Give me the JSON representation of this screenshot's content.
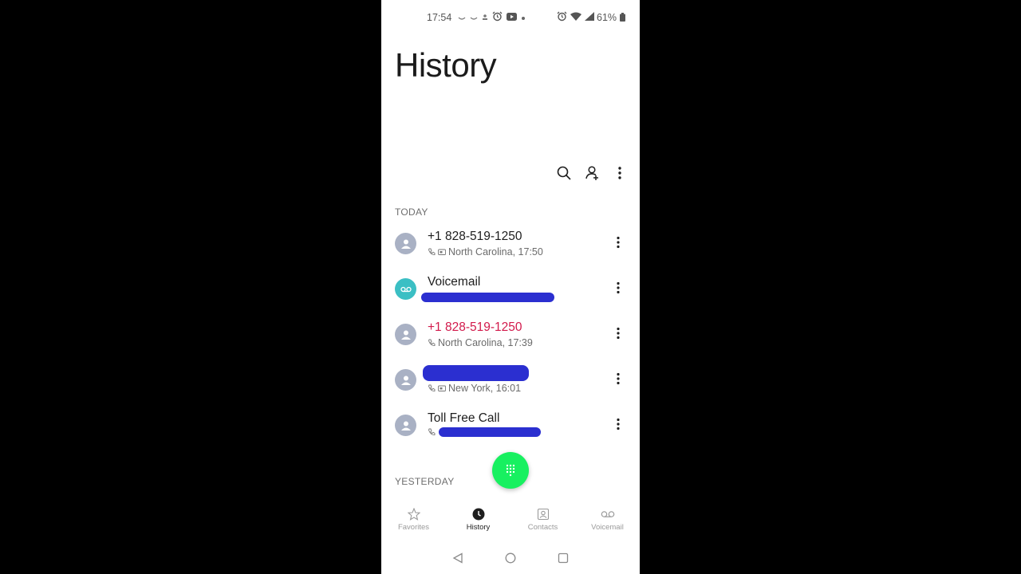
{
  "status_bar": {
    "time": "17:54",
    "battery": "61%"
  },
  "header": {
    "title": "History"
  },
  "sections": {
    "today": "TODAY",
    "yesterday": "YESTERDAY"
  },
  "calls": [
    {
      "name": "+1 828-519-1250",
      "detail": "North Carolina, 17:50",
      "missed": false
    },
    {
      "name": "Voicemail",
      "detail": "",
      "missed": false
    },
    {
      "name": "+1 828-519-1250",
      "detail": "North Carolina, 17:39",
      "missed": true
    },
    {
      "name": "",
      "detail": "New York, 16:01",
      "missed": false
    },
    {
      "name": "Toll Free Call",
      "detail": "",
      "missed": false
    }
  ],
  "bottom_nav": [
    {
      "label": "Favorites",
      "icon": "star-icon"
    },
    {
      "label": "History",
      "icon": "clock-icon",
      "active": true
    },
    {
      "label": "Contacts",
      "icon": "contacts-icon"
    },
    {
      "label": "Voicemail",
      "icon": "voicemail-icon"
    }
  ],
  "colors": {
    "missed": "#d2194b",
    "fab": "#18f060",
    "voicemail_avatar": "#3bbfc4",
    "avatar": "#a9b1c4",
    "redaction": "#2b2fd0"
  }
}
